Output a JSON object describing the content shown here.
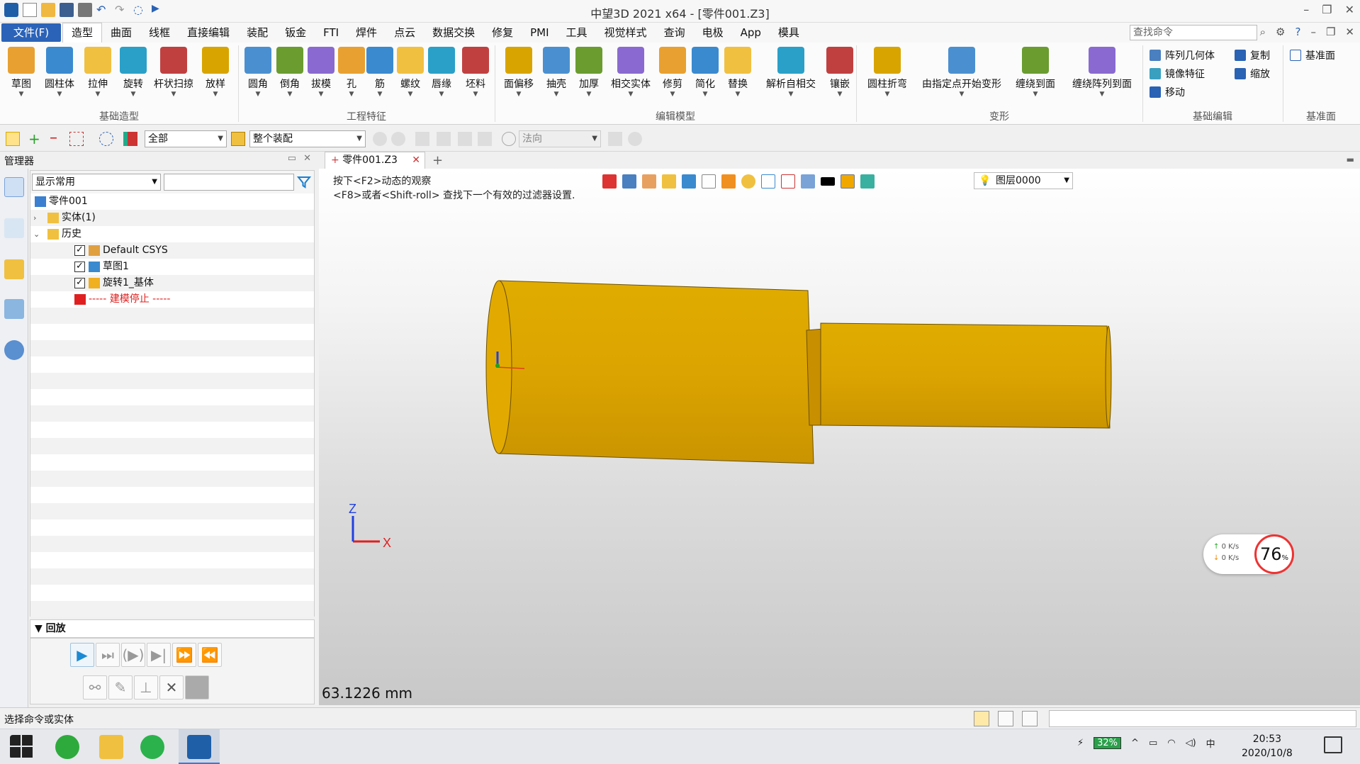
{
  "window": {
    "title": "中望3D 2021 x64 - [零件001.Z3]",
    "controls": [
      "–",
      "❐",
      "✕"
    ]
  },
  "menu": {
    "file": "文件(F)",
    "tabs": [
      "造型",
      "曲面",
      "线框",
      "直接编辑",
      "装配",
      "钣金",
      "FTI",
      "焊件",
      "点云",
      "数据交换",
      "修复",
      "PMI",
      "工具",
      "视觉样式",
      "查询",
      "电极",
      "App",
      "模具"
    ],
    "active_tab": "造型",
    "search_placeholder": "查找命令"
  },
  "ribbon": {
    "groups": [
      {
        "label": "基础造型",
        "items": [
          "草图",
          "圆柱体",
          "拉伸",
          "旋转",
          "杆状扫掠",
          "放样"
        ]
      },
      {
        "label": "工程特征",
        "items": [
          "圆角",
          "倒角",
          "拔模",
          "孔",
          "筋",
          "螺纹",
          "唇缘",
          "坯料"
        ]
      },
      {
        "label": "编辑模型",
        "items": [
          "面偏移",
          "抽壳",
          "加厚",
          "相交实体",
          "修剪",
          "简化",
          "替换",
          "解析自相交",
          "镶嵌"
        ]
      },
      {
        "label": "变形",
        "items": [
          "圆柱折弯",
          "由指定点开始变形",
          "缠绕到面",
          "缠绕阵列到面"
        ]
      },
      {
        "label": "基础编辑",
        "items": [
          "阵列几何体",
          "复制",
          "镜像特征",
          "缩放",
          "移动"
        ]
      },
      {
        "label": "基准面",
        "items": [
          "基准面"
        ]
      }
    ]
  },
  "toolbar2": {
    "filter": "全部",
    "scope": "整个装配",
    "direction": "法向"
  },
  "manager": {
    "title": "管理器",
    "filter_combo": "显示常用",
    "tree": [
      {
        "label": "零件001",
        "level": 0
      },
      {
        "label": "实体(1)",
        "level": 1
      },
      {
        "label": "历史",
        "level": 1
      },
      {
        "label": "Default CSYS",
        "level": 2
      },
      {
        "label": "草图1",
        "level": 2
      },
      {
        "label": "旋转1_基体",
        "level": 2
      },
      {
        "label": "----- 建模停止 -----",
        "level": 2
      }
    ],
    "playback_title": "回放"
  },
  "document": {
    "tab": "零件001.Z3",
    "hint_line1": "按下<F2>动态的观察",
    "hint_line2": "<F8>或者<Shift-roll> 查找下一个有效的过滤器设置.",
    "layer": "图层0000",
    "measure": "63.1226 mm",
    "axis_x": "X",
    "axis_z": "Z",
    "speed_up": "0 K/s",
    "speed_down": "0 K/s",
    "percent": "76",
    "percent_unit": "%"
  },
  "colors": {
    "part": "#d9a300",
    "part_dark": "#b88700",
    "accent": "#2b63b8"
  },
  "status": {
    "text": "选择命令或实体"
  },
  "taskbar": {
    "battery": "32%",
    "time": "20:53",
    "date": "2020/10/8"
  }
}
